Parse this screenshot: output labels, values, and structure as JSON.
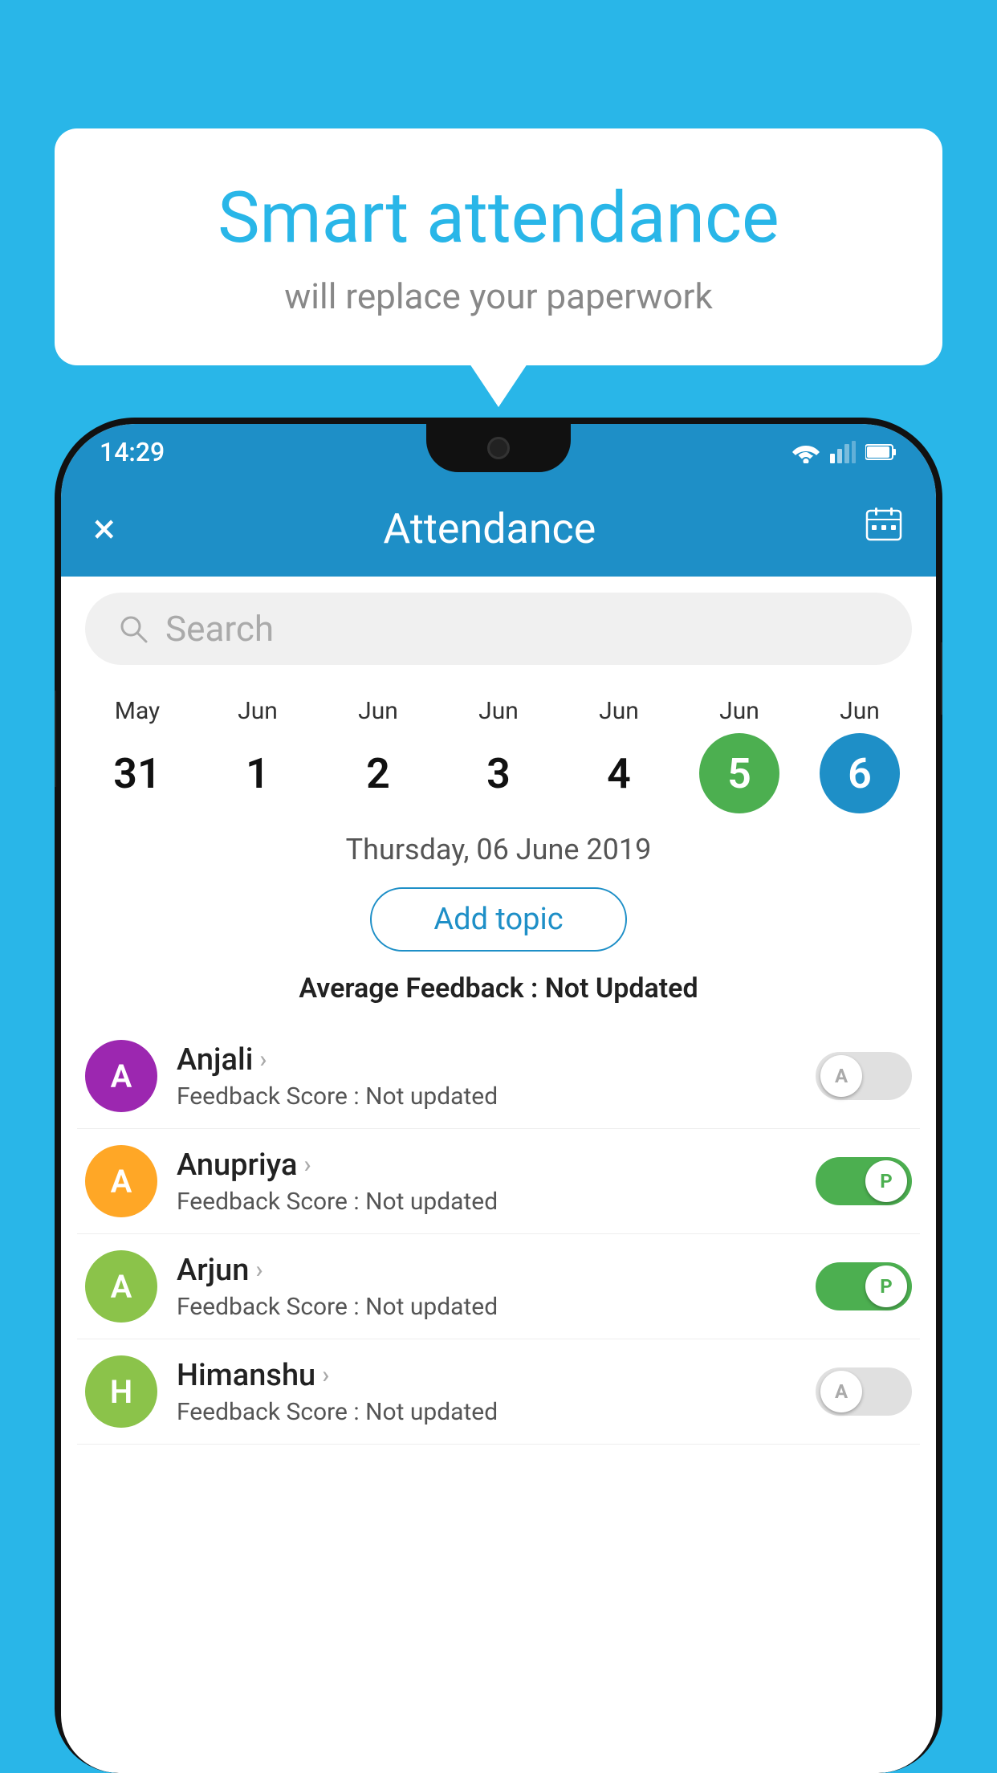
{
  "background_color": "#29b6e8",
  "speech_bubble": {
    "title": "Smart attendance",
    "subtitle": "will replace your paperwork"
  },
  "phone": {
    "status_bar": {
      "time": "14:29"
    },
    "app_bar": {
      "title": "Attendance",
      "close_label": "×",
      "calendar_icon": "calendar-icon"
    },
    "search": {
      "placeholder": "Search"
    },
    "dates": [
      {
        "month": "May",
        "day": "31",
        "state": "normal"
      },
      {
        "month": "Jun",
        "day": "1",
        "state": "normal"
      },
      {
        "month": "Jun",
        "day": "2",
        "state": "normal"
      },
      {
        "month": "Jun",
        "day": "3",
        "state": "normal"
      },
      {
        "month": "Jun",
        "day": "4",
        "state": "normal"
      },
      {
        "month": "Jun",
        "day": "5",
        "state": "today"
      },
      {
        "month": "Jun",
        "day": "6",
        "state": "selected"
      }
    ],
    "selected_date_label": "Thursday, 06 June 2019",
    "add_topic_label": "Add topic",
    "feedback_summary_prefix": "Average Feedback : ",
    "feedback_summary_value": "Not Updated",
    "students": [
      {
        "name": "Anjali",
        "avatar_letter": "A",
        "avatar_color": "#9c27b0",
        "feedback_label": "Feedback Score : ",
        "feedback_value": "Not updated",
        "toggle_state": "off",
        "toggle_label": "A"
      },
      {
        "name": "Anupriya",
        "avatar_letter": "A",
        "avatar_color": "#ffa726",
        "feedback_label": "Feedback Score : ",
        "feedback_value": "Not updated",
        "toggle_state": "on",
        "toggle_label": "P"
      },
      {
        "name": "Arjun",
        "avatar_letter": "A",
        "avatar_color": "#8bc34a",
        "feedback_label": "Feedback Score : ",
        "feedback_value": "Not updated",
        "toggle_state": "on",
        "toggle_label": "P"
      },
      {
        "name": "Himanshu",
        "avatar_letter": "H",
        "avatar_color": "#8bc34a",
        "feedback_label": "Feedback Score : ",
        "feedback_value": "Not updated",
        "toggle_state": "off",
        "toggle_label": "A"
      }
    ]
  }
}
